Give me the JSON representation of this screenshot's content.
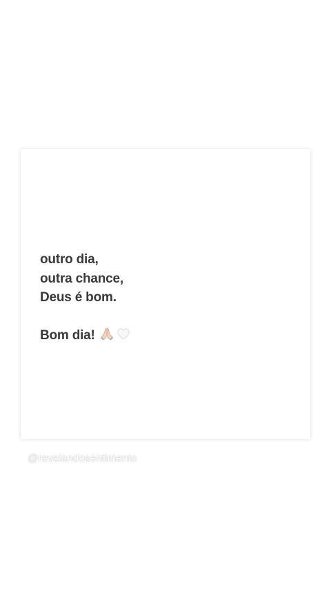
{
  "post": {
    "lines": [
      "outro dia,",
      "outra chance,",
      "Deus é bom."
    ],
    "closing": "Bom dia!",
    "emojis": [
      "folded-hands",
      "white-heart"
    ]
  },
  "footer": {
    "handle": "@revelandosentimento"
  }
}
